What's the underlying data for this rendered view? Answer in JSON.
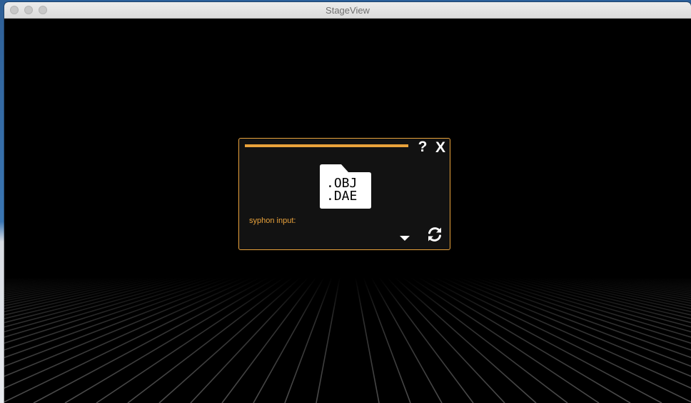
{
  "window": {
    "title": "StageView"
  },
  "dialog": {
    "help_label": "?",
    "close_label": "X",
    "file_icon": {
      "name": "obj-dae-file-icon",
      "line1": ".OBJ",
      "line2": ".DAE"
    },
    "syphon_label": "syphon input:",
    "dropdown_icon": "caret-down-icon",
    "refresh_icon": "refresh-icon"
  },
  "colors": {
    "accent": "#e9a23b",
    "dialog_bg": "#121212",
    "viewport_bg": "#000000",
    "grid": "#555555"
  }
}
